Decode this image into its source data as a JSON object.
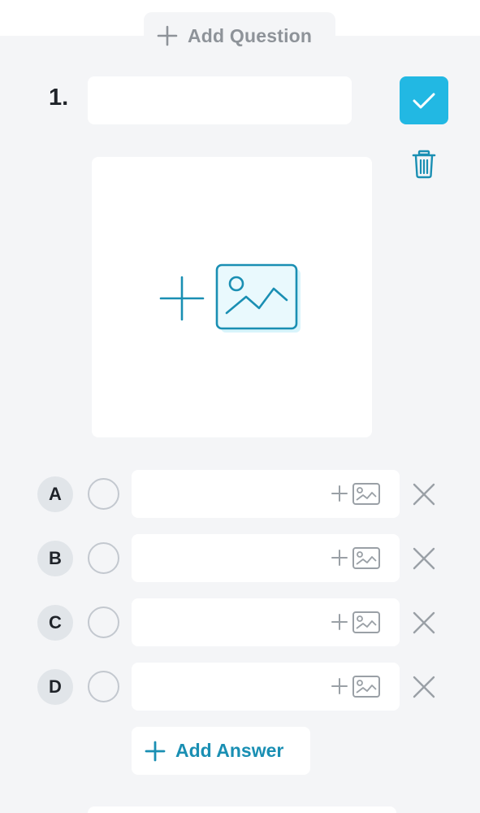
{
  "header": {
    "add_question_label": "Add Question"
  },
  "question": {
    "number": "1.",
    "text_value": "",
    "text_placeholder": ""
  },
  "answers": [
    {
      "letter": "A",
      "value": ""
    },
    {
      "letter": "B",
      "value": ""
    },
    {
      "letter": "C",
      "value": ""
    },
    {
      "letter": "D",
      "value": ""
    }
  ],
  "add_answer_label": "Add Answer",
  "icons": {
    "add_question": "plus-icon",
    "confirm": "check-icon",
    "delete": "trash-icon",
    "add_image": "add-image-icon",
    "answer_image": "add-image-icon",
    "remove_answer": "close-icon",
    "add_answer": "plus-icon"
  },
  "colors": {
    "accent": "#22b8e3",
    "accent_dark": "#1a8fb3",
    "panel_bg": "#f4f5f7",
    "muted": "#8e9399",
    "text": "#1f2329"
  }
}
